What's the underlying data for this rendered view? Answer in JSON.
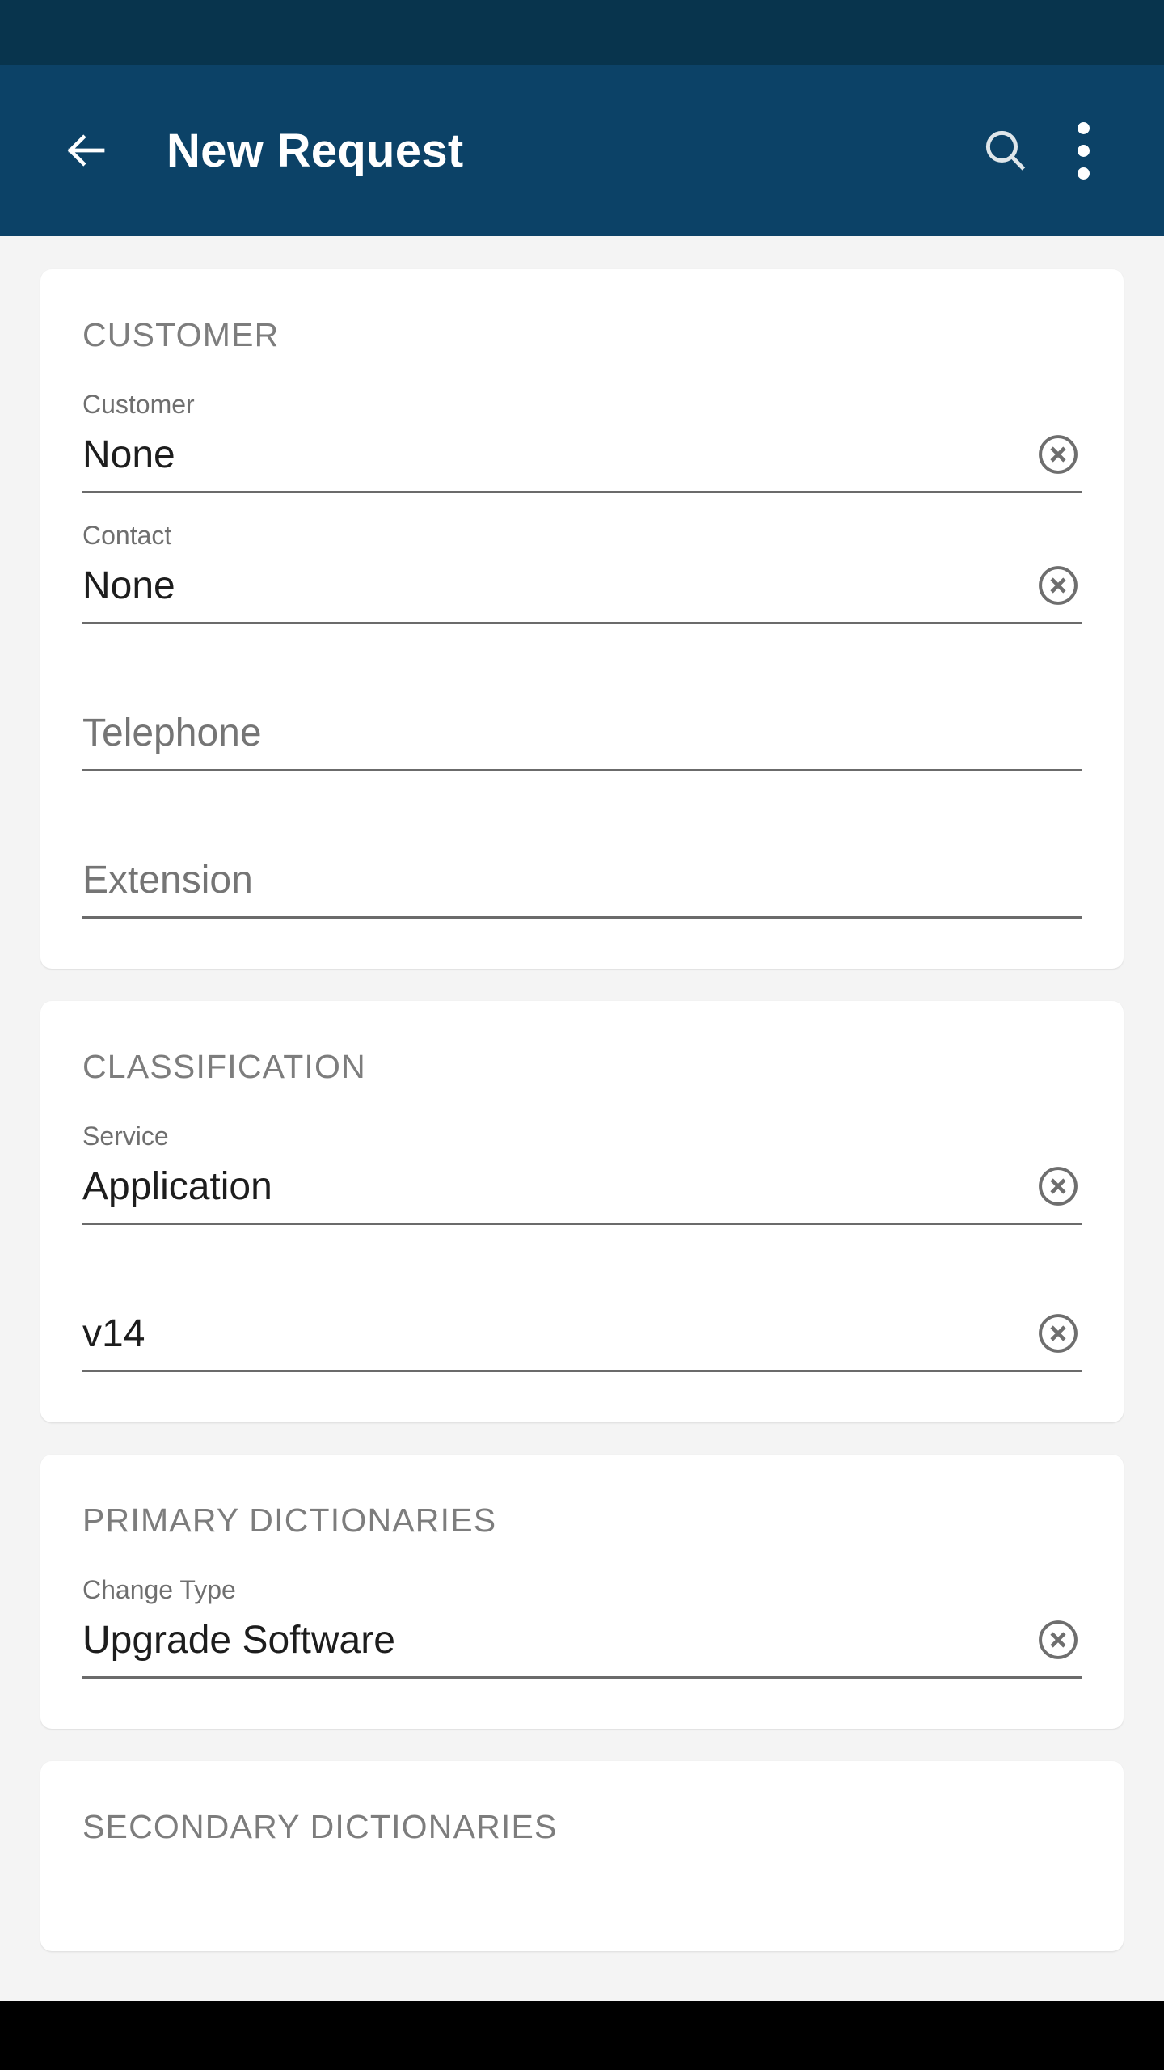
{
  "app_bar": {
    "title": "New Request",
    "back_icon": "arrow-left-icon",
    "search_icon": "search-icon",
    "overflow_icon": "more-vertical-icon",
    "background_color": "#0c4267",
    "status_bar_color": "#08344d"
  },
  "colors": {
    "page_background": "#f4f4f4",
    "card_background": "#ffffff",
    "section_header": "#7d7d7d",
    "field_label": "#6f6f6f",
    "field_value": "#1d1d1d",
    "field_underline": "#6b6b6b",
    "clear_icon": "#6e6e6e",
    "nav_bar": "#000000"
  },
  "sections": [
    {
      "title": "CUSTOMER",
      "fields": [
        {
          "label": "Customer",
          "value": "None",
          "placeholder": "",
          "clearable": true
        },
        {
          "label": "Contact",
          "value": "None",
          "placeholder": "",
          "clearable": true
        },
        {
          "label": "",
          "value": "",
          "placeholder": "Telephone",
          "clearable": false
        },
        {
          "label": "",
          "value": "",
          "placeholder": "Extension",
          "clearable": false
        }
      ]
    },
    {
      "title": "CLASSIFICATION",
      "fields": [
        {
          "label": "Service",
          "value": "Application",
          "placeholder": "",
          "clearable": true
        },
        {
          "label": "",
          "value": "v14",
          "placeholder": "",
          "clearable": true
        }
      ]
    },
    {
      "title": "PRIMARY DICTIONARIES",
      "fields": [
        {
          "label": "Change Type",
          "value": "Upgrade Software",
          "placeholder": "",
          "clearable": true
        }
      ]
    },
    {
      "title": "SECONDARY DICTIONARIES",
      "fields": []
    }
  ]
}
